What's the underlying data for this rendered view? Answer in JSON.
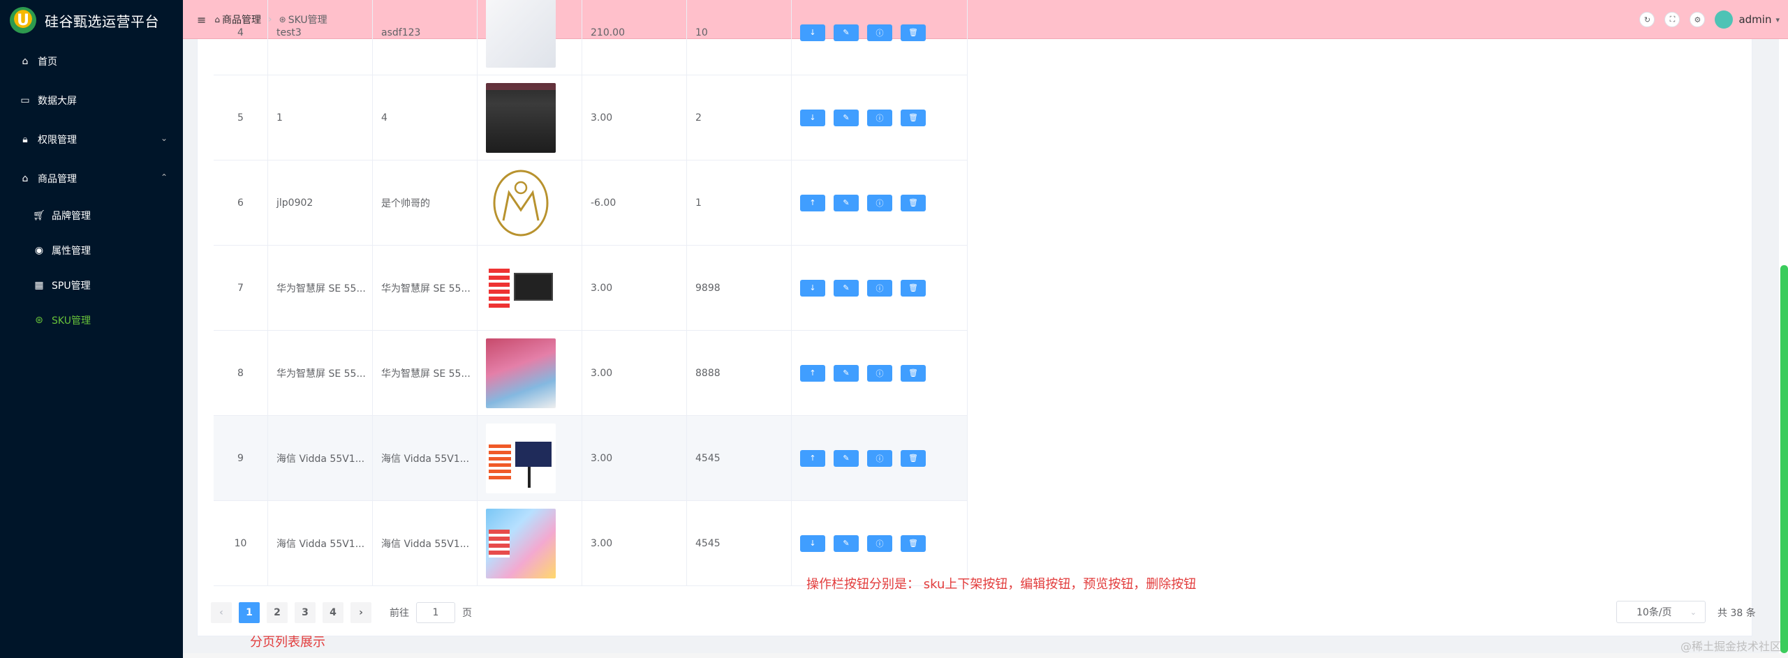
{
  "app": {
    "title": "硅谷甄选运营平台"
  },
  "sidebar": {
    "items": [
      {
        "label": "首页",
        "icon": "home-icon"
      },
      {
        "label": "数据大屏",
        "icon": "monitor-icon"
      },
      {
        "label": "权限管理",
        "icon": "lock-icon"
      },
      {
        "label": "商品管理",
        "icon": "goods-icon"
      }
    ],
    "subitems": [
      {
        "label": "品牌管理",
        "icon": "cart-icon"
      },
      {
        "label": "属性管理",
        "icon": "chrome-icon"
      },
      {
        "label": "SPU管理",
        "icon": "calendar-icon"
      },
      {
        "label": "SKU管理",
        "icon": "basketball-icon"
      }
    ]
  },
  "header": {
    "breadcrumb": [
      "商品管理",
      "SKU管理"
    ],
    "user": "admin"
  },
  "table": {
    "rows": [
      {
        "index": "4",
        "name": "test3",
        "desc": "asdf123",
        "price": "210.00",
        "weight": "10",
        "toggle": "down"
      },
      {
        "index": "5",
        "name": "1",
        "desc": "4",
        "price": "3.00",
        "weight": "2",
        "toggle": "down"
      },
      {
        "index": "6",
        "name": "jlp0902",
        "desc": "是个帅哥的",
        "price": "-6.00",
        "weight": "1",
        "toggle": "up"
      },
      {
        "index": "7",
        "name": "华为智慧屏 SE 55...",
        "desc": "华为智慧屏 SE 55...",
        "price": "3.00",
        "weight": "9898",
        "toggle": "down"
      },
      {
        "index": "8",
        "name": "华为智慧屏 SE 55...",
        "desc": "华为智慧屏 SE 55...",
        "price": "3.00",
        "weight": "8888",
        "toggle": "up"
      },
      {
        "index": "9",
        "name": "海信 Vidda 55V1...",
        "desc": "海信 Vidda 55V1...",
        "price": "3.00",
        "weight": "4545",
        "toggle": "up"
      },
      {
        "index": "10",
        "name": "海信 Vidda 55V1...",
        "desc": "海信 Vidda 55V1...",
        "price": "3.00",
        "weight": "4545",
        "toggle": "down"
      }
    ]
  },
  "annotations": {
    "ops": "操作栏按钮分别是： sku上下架按钮，编辑按钮，预览按钮，删除按钮",
    "pagination": "分页列表展示"
  },
  "pagination": {
    "pages": [
      "1",
      "2",
      "3",
      "4"
    ],
    "current": "1",
    "goto_prefix": "前往",
    "goto_value": "1",
    "goto_suffix": "页",
    "page_size": "10条/页",
    "total": "共 38 条"
  },
  "watermark": "@稀土掘金技术社区",
  "colors": {
    "sidebar": "#001529",
    "header": "#ffc0cb",
    "primary": "#409eff",
    "active": "#67c23a",
    "note": "#e23c3c"
  }
}
